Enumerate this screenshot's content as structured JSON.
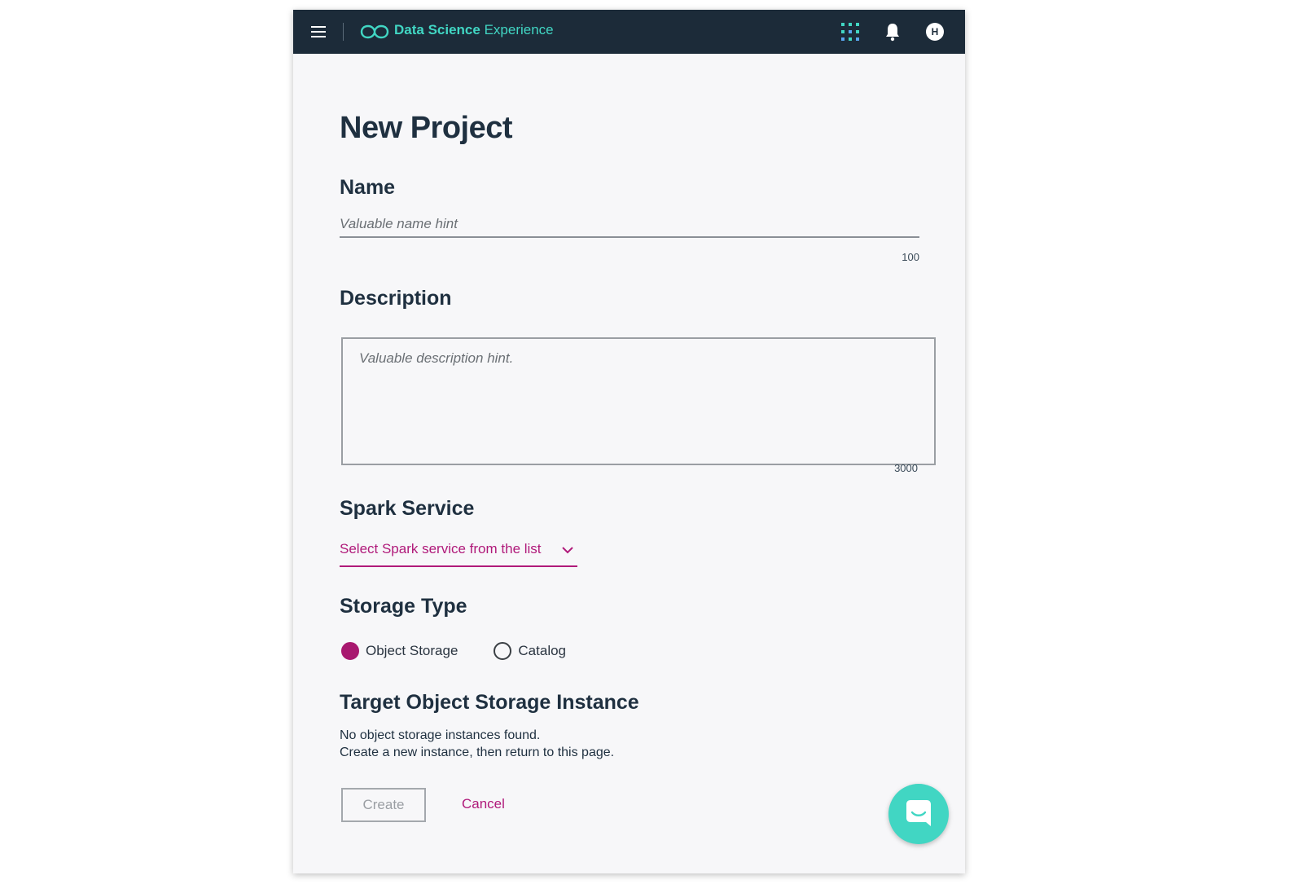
{
  "header": {
    "brand_bold": "Data Science",
    "brand_light": "Experience",
    "avatar_initial": "H",
    "menu_icon": "hamburger-menu-icon",
    "apps_icon": "grid-apps-icon",
    "notifications_icon": "bell-icon"
  },
  "page": {
    "title": "New Project"
  },
  "name_field": {
    "label": "Name",
    "placeholder": "Valuable name hint",
    "value": "",
    "max_chars": "100"
  },
  "description_field": {
    "label": "Description",
    "placeholder": "Valuable description hint.",
    "value": "",
    "max_chars": "3000"
  },
  "spark_service": {
    "label": "Spark Service",
    "selected": "Select Spark service from the list"
  },
  "storage_type": {
    "label": "Storage Type",
    "options": [
      {
        "label": "Object Storage",
        "checked": true
      },
      {
        "label": "Catalog",
        "checked": false
      }
    ]
  },
  "target_storage": {
    "label": "Target Object Storage Instance",
    "line1": "No object storage instances found.",
    "line2": "Create a new instance, then return to this page."
  },
  "actions": {
    "create_label": "Create",
    "cancel_label": "Cancel"
  },
  "colors": {
    "topbar": "#1c2b39",
    "brand_accent": "#41d6c3",
    "magenta_accent": "#b01a7a",
    "page_background": "#f7f7f9"
  }
}
